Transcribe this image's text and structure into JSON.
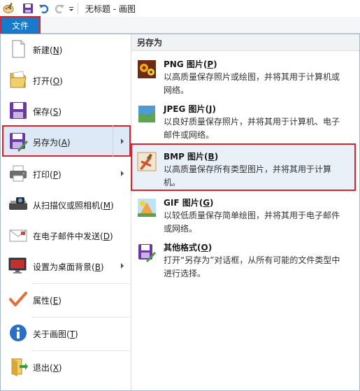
{
  "window": {
    "title": "无标题 - 画图"
  },
  "ribbon": {
    "file_tab": "文件"
  },
  "menu": {
    "items": [
      {
        "label": "新建(",
        "key": "N",
        "tail": ")",
        "icon": "new-document-icon"
      },
      {
        "label": "打开(",
        "key": "O",
        "tail": ")",
        "icon": "open-folder-icon"
      },
      {
        "label": "保存(",
        "key": "S",
        "tail": ")",
        "icon": "save-disk-icon"
      },
      {
        "label": "另存为(",
        "key": "A",
        "tail": ")",
        "icon": "save-as-icon"
      },
      {
        "label": "打印(",
        "key": "P",
        "tail": ")",
        "icon": "printer-icon"
      },
      {
        "label": "从扫描仪或照相机(",
        "key": "M",
        "tail": ")",
        "icon": "scanner-icon"
      },
      {
        "label": "在电子邮件中发送(",
        "key": "D",
        "tail": ")",
        "icon": "email-icon"
      },
      {
        "label": "设置为桌面背景(",
        "key": "B",
        "tail": ")",
        "icon": "desktop-background-icon"
      },
      {
        "label": "属性(",
        "key": "E",
        "tail": ")",
        "icon": "checkmark-icon"
      },
      {
        "label": "关于画图(",
        "key": "T",
        "tail": ")",
        "icon": "info-icon"
      },
      {
        "label": "退出(",
        "key": "X",
        "tail": ")",
        "icon": "exit-icon"
      }
    ]
  },
  "saveas": {
    "header": "另存为",
    "items": [
      {
        "title": "PNG 图片(",
        "key": "P",
        "tail": ")",
        "desc": "以高质量保存照片或绘图，并将其用于计算机或网络。",
        "icon": "png-image-icon"
      },
      {
        "title": "JPEG 图片(",
        "key": "J",
        "tail": ")",
        "desc": "以良好质量保存照片，并将其用于计算机、电子邮件或网络。",
        "icon": "jpeg-image-icon"
      },
      {
        "title": "BMP 图片(",
        "key": "B",
        "tail": ")",
        "desc": "以高质量保存所有类型图片，并将其用于计算机。",
        "icon": "bmp-image-icon"
      },
      {
        "title": "GIF 图片(",
        "key": "G",
        "tail": ")",
        "desc": "以较低质量保存简单绘图，并将其用于电子邮件或网络。",
        "icon": "gif-image-icon"
      },
      {
        "title": "其他格式(",
        "key": "O",
        "tail": ")",
        "desc": "打开“另存为”对话框，从所有可能的文件类型中进行选择。",
        "icon": "other-formats-icon"
      }
    ]
  },
  "colors": {
    "accent": "#1979ca",
    "highlight_border": "#e0212b",
    "hover": "#dde9f6"
  }
}
